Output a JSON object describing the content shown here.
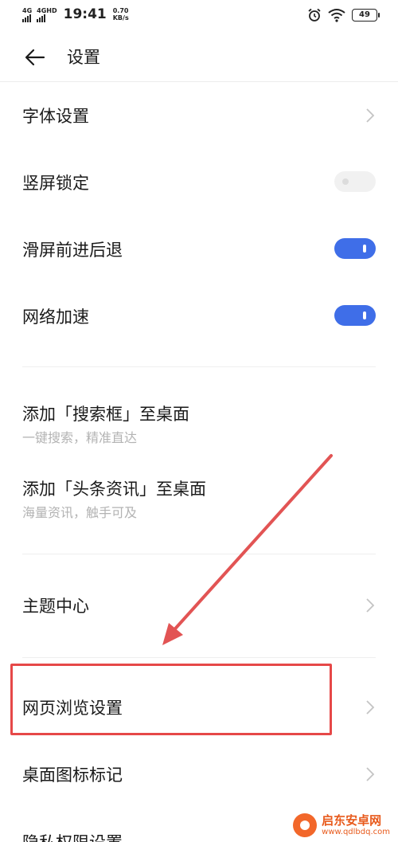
{
  "status_bar": {
    "sim1_label": "4G",
    "sim2_label": "4GHD",
    "time": "19:41",
    "speed_value": "0.70",
    "speed_unit": "KB/s",
    "battery": "49",
    "icons": [
      "alarm-icon",
      "wifi-icon",
      "battery-icon"
    ]
  },
  "header": {
    "title": "设置",
    "back_icon": "back-arrow-icon"
  },
  "rows": [
    {
      "label": "字体设置",
      "control": "chevron"
    },
    {
      "label": "竖屏锁定",
      "control": "toggle",
      "on": false
    },
    {
      "label": "滑屏前进后退",
      "control": "toggle",
      "on": true
    },
    {
      "label": "网络加速",
      "control": "toggle",
      "on": true
    },
    {
      "label": "添加「搜索框」至桌面",
      "sub": "一键搜索，精准直达"
    },
    {
      "label": "添加「头条资讯」至桌面",
      "sub": "海量资讯，触手可及"
    },
    {
      "label": "主题中心",
      "control": "chevron"
    },
    {
      "label": "网页浏览设置",
      "control": "chevron"
    },
    {
      "label": "桌面图标标记",
      "control": "chevron"
    },
    {
      "label": "隐私权限设置",
      "control": "chevron"
    }
  ],
  "colors": {
    "accent": "#3f6ee8",
    "annotation": "#e64848"
  },
  "watermark": {
    "main": "启东安卓网",
    "sub": "www.qdlbdq.com"
  }
}
